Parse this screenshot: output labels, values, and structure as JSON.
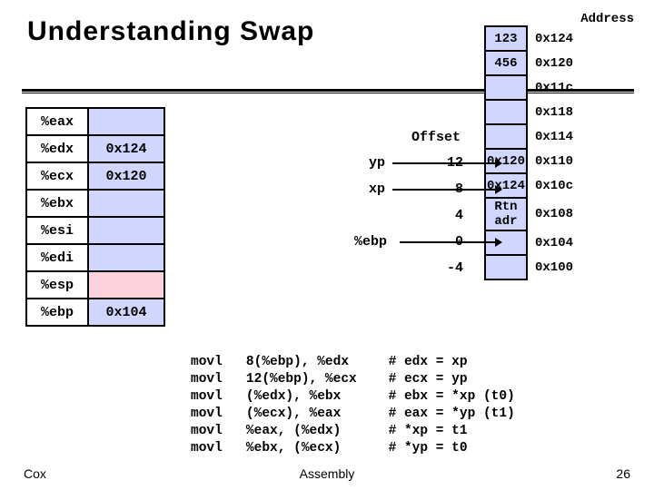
{
  "title": "Understanding Swap",
  "address_header": "Address",
  "offset_header": "Offset",
  "registers": [
    {
      "name": "%eax",
      "value": ""
    },
    {
      "name": "%edx",
      "value": "0x124"
    },
    {
      "name": "%ecx",
      "value": "0x120"
    },
    {
      "name": "%ebx",
      "value": ""
    },
    {
      "name": "%esi",
      "value": ""
    },
    {
      "name": "%edi",
      "value": ""
    },
    {
      "name": "%esp",
      "value": "",
      "highlight": true
    },
    {
      "name": "%ebp",
      "value": "0x104"
    }
  ],
  "memory": [
    {
      "value": "123",
      "addr": "0x124"
    },
    {
      "value": "456",
      "addr": "0x120"
    },
    {
      "value": "",
      "addr": "0x11c"
    },
    {
      "value": "",
      "addr": "0x118"
    },
    {
      "value": "",
      "addr": "0x114"
    },
    {
      "value": "0x120",
      "addr": "0x110"
    },
    {
      "value": "0x124",
      "addr": "0x10c"
    },
    {
      "value": "Rtn adr",
      "addr": "0x108"
    },
    {
      "value": "",
      "addr": "0x104"
    },
    {
      "value": "",
      "addr": "0x100"
    }
  ],
  "offsets": [
    {
      "label": "yp",
      "off": "12"
    },
    {
      "label": "xp",
      "off": "8"
    },
    {
      "label": "",
      "off": "4"
    },
    {
      "label": "%ebp",
      "off": "0"
    },
    {
      "label": "",
      "off": "-4"
    }
  ],
  "code": {
    "op": [
      "movl",
      "movl",
      "movl",
      "movl",
      "movl",
      "movl"
    ],
    "arg": [
      "8(%ebp), %edx",
      "12(%ebp), %ecx",
      "(%edx), %ebx",
      "(%ecx), %eax",
      "%eax, (%edx)",
      "%ebx, (%ecx)"
    ],
    "cmt": [
      "# edx = xp",
      "# ecx = yp",
      "# ebx = *xp (t0)",
      "# eax = *yp (t1)",
      "# *xp = t1",
      "# *yp = t0"
    ]
  },
  "footer": {
    "left": "Cox",
    "center": "Assembly",
    "right": "26"
  }
}
